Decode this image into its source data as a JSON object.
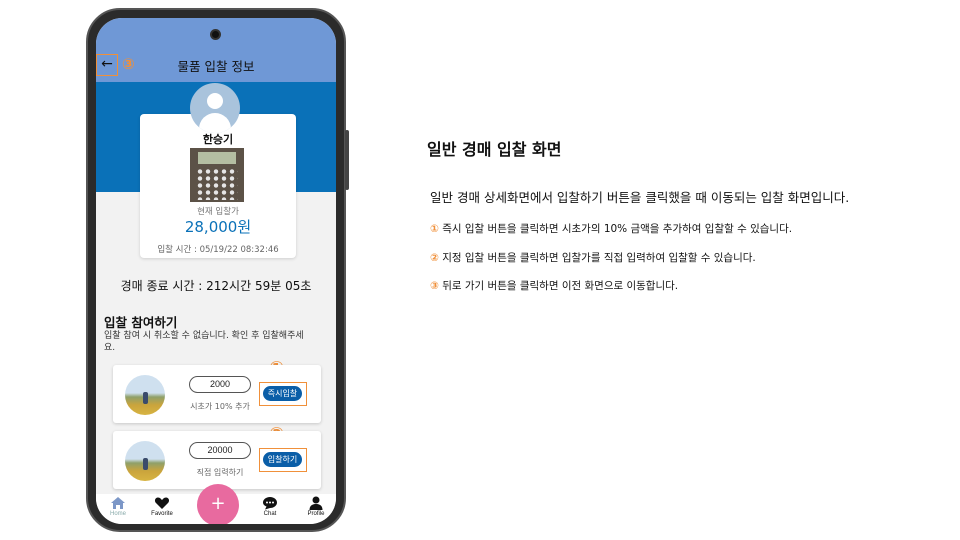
{
  "app": {
    "title": "물품 입찰 정보",
    "back_icon": "←",
    "callout_back": "③",
    "seller_name": "한승기",
    "price_label": "현재 입찰가",
    "price": "28,000원",
    "bid_time": "입찰 시간 : 05/19/22 08:32:46",
    "end_time": "경매 종료 시간 : 212시간 59분 05초",
    "section_title": "입찰 참여하기",
    "section_desc": "입찰 참여 시 취소할 수 없습니다. 확인 후 입찰해주세요.",
    "bids": [
      {
        "callout": "①",
        "value": "2000",
        "hint": "시초가 10% 추가",
        "button": "즉시입찰"
      },
      {
        "callout": "②",
        "value": "20000",
        "hint": "직접 입력하기",
        "button": "입찰하기"
      }
    ],
    "nav": {
      "home": "Home",
      "favorite": "Favorite",
      "add": "+",
      "chat": "Chat",
      "profile": "Profile"
    },
    "colors": {
      "appbar": "#6f98d6",
      "band": "#0a71b8",
      "accent": "#f0903a",
      "fab": "#e86a9f"
    }
  },
  "description": {
    "title": "일반 경매 입찰 화면",
    "main": "일반 경매 상세화면에서 입찰하기 버튼을 클릭했을 때 이동되는 입찰 화면입니다.",
    "items": [
      {
        "num": "①",
        "text": " 즉시 입찰 버튼을 클릭하면 시초가의 10% 금액을 추가하여 입찰할 수 있습니다."
      },
      {
        "num": "②",
        "text": " 지정 입찰 버튼을 클릭하면 입찰가를 직접 입력하여 입찰할 수 있습니다."
      },
      {
        "num": "③",
        "text": " 뒤로 가기 버튼을 클릭하면 이전 화면으로 이동합니다."
      }
    ]
  }
}
